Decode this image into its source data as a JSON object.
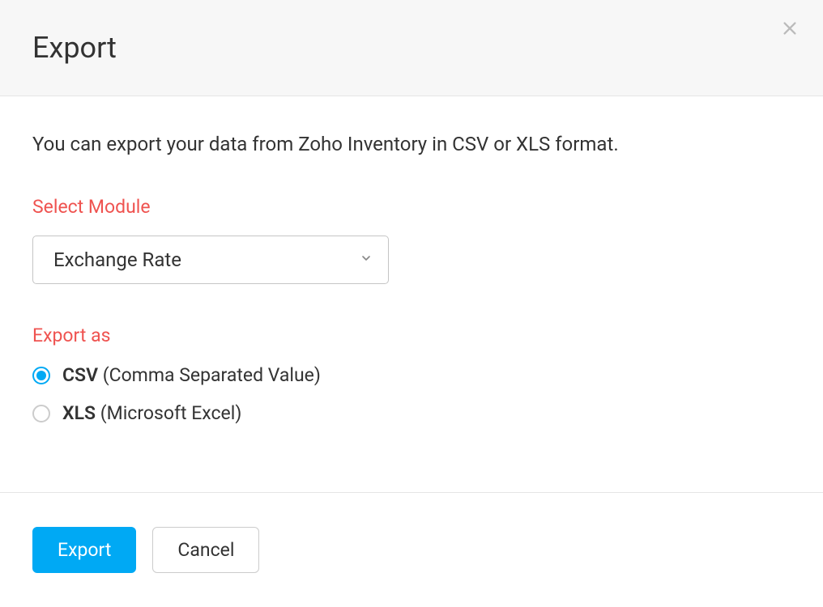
{
  "header": {
    "title": "Export"
  },
  "body": {
    "description": "You can export your data from Zoho Inventory in CSV or XLS format.",
    "select_module_label": "Select Module",
    "selected_module": "Exchange Rate",
    "export_as_label": "Export as",
    "options": {
      "csv": {
        "abbr": "CSV",
        "desc": " (Comma Separated Value)",
        "selected": true
      },
      "xls": {
        "abbr": "XLS",
        "desc": " (Microsoft Excel)",
        "selected": false
      }
    }
  },
  "footer": {
    "export_label": "Export",
    "cancel_label": "Cancel"
  }
}
